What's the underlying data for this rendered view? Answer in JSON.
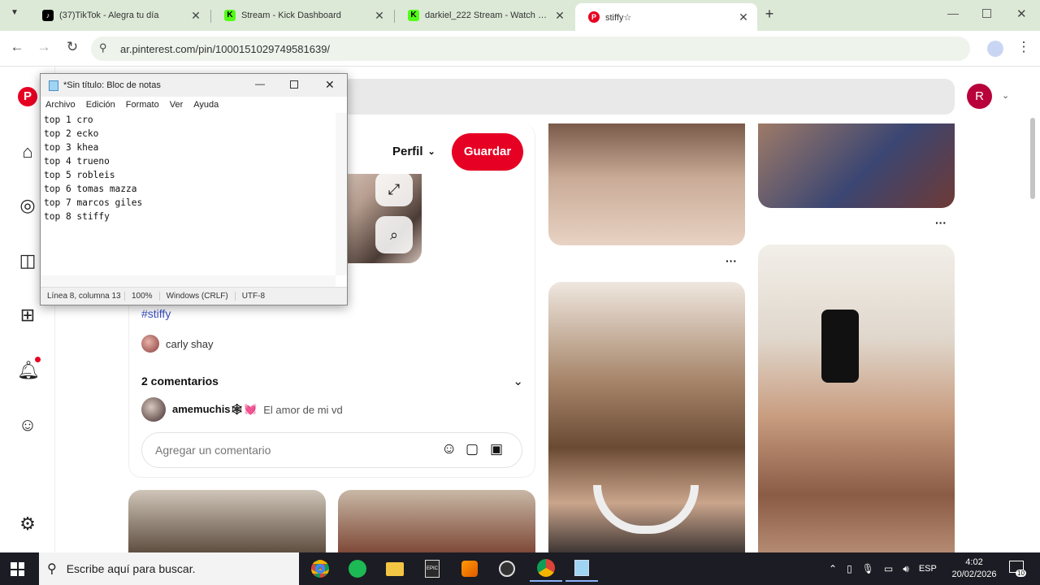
{
  "browser": {
    "tabs": [
      {
        "title": "(37)TikTok - Alegra tu día",
        "favicon": "tiktok-icon",
        "color": "#000000"
      },
      {
        "title": "Stream - Kick Dashboard",
        "favicon": "kick-icon",
        "color": "#53fc18"
      },
      {
        "title": "darkiel_222 Stream - Watch Live",
        "favicon": "kick-icon",
        "color": "#53fc18"
      },
      {
        "title": "stiffy☆",
        "favicon": "pinterest-icon",
        "color": "#e60023"
      }
    ],
    "active_tab": 3,
    "new_tab": "+",
    "url": "ar.pinterest.com/pin/1000151029749581639/"
  },
  "pinterest": {
    "avatar_letter": "R",
    "profile_label": "Perfil",
    "save_label": "Guardar",
    "hashtag": "#stiffy",
    "author": "carly shay",
    "comments_title": "2 comentarios",
    "comment_user": "amemuchis🕸💓",
    "comment_text": "El amor de mi vd",
    "comment_placeholder": "Agregar un comentario",
    "card_more": "···"
  },
  "notepad": {
    "title": "*Sin título: Bloc de notas",
    "menu": [
      "Archivo",
      "Edición",
      "Formato",
      "Ver",
      "Ayuda"
    ],
    "lines": [
      "top 1 cro",
      "top 2 ecko",
      "top 3 khea",
      "top 4 trueno",
      "top 5 robleis",
      "top 6 tomas mazza",
      "top 7 marcos giles",
      "top 8 stiffy"
    ],
    "status_pos": "Línea 8, columna 13",
    "status_zoom": "100%",
    "status_eol": "Windows (CRLF)",
    "status_enc": "UTF-8"
  },
  "taskbar": {
    "search_placeholder": "Escribe aquí para buscar.",
    "lang": "ESP",
    "time": "4:02",
    "date": "20/02/2026",
    "notif_count": "10"
  }
}
